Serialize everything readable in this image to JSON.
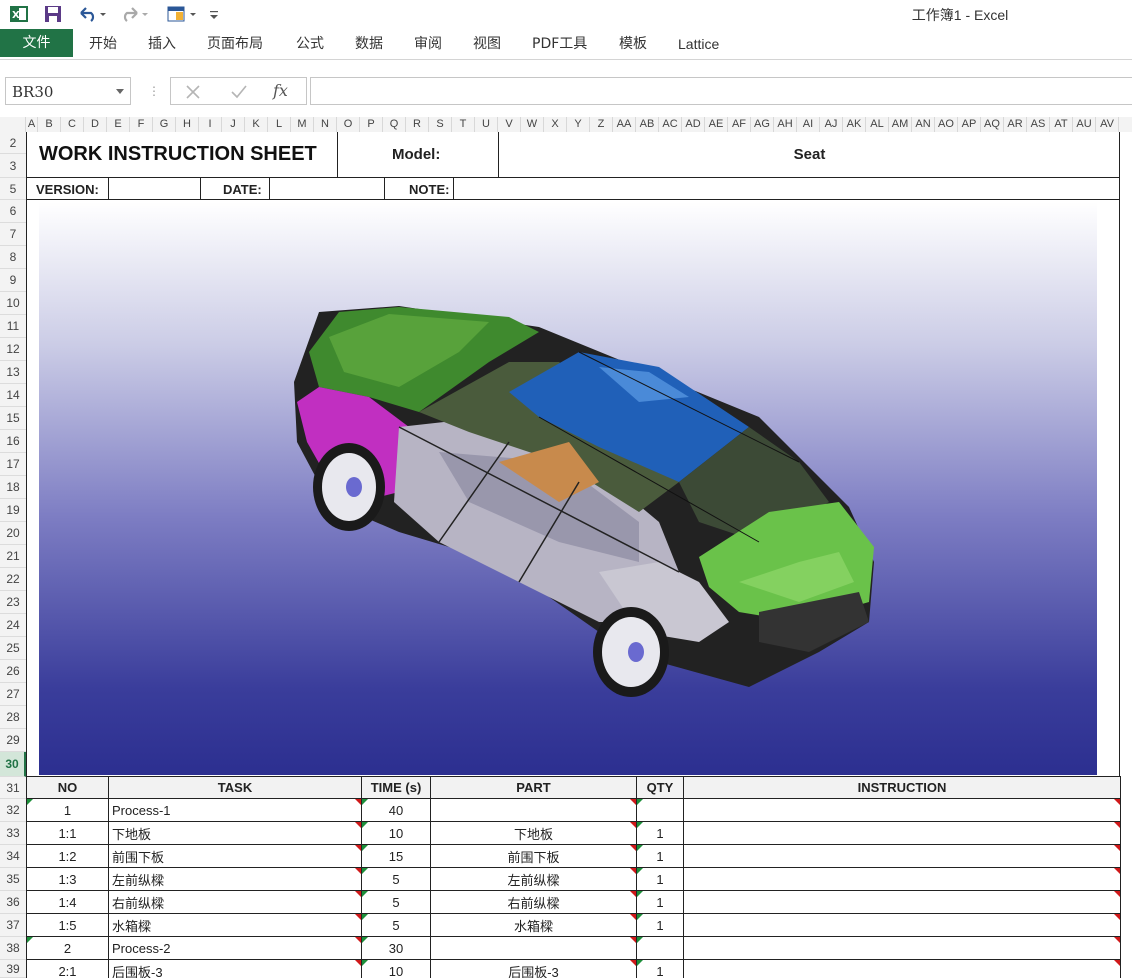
{
  "window": {
    "title": "工作簿1 - Excel"
  },
  "ribbon": {
    "file_tab": "文件",
    "tabs": [
      "开始",
      "插入",
      "页面布局",
      "公式",
      "数据",
      "审阅",
      "视图",
      "PDF工具",
      "模板",
      "Lattice"
    ]
  },
  "formula_bar": {
    "name_box": "BR30",
    "fx": "fx",
    "content": ""
  },
  "columns": [
    "A",
    "B",
    "C",
    "D",
    "E",
    "F",
    "G",
    "H",
    "I",
    "J",
    "K",
    "L",
    "M",
    "N",
    "O",
    "P",
    "Q",
    "R",
    "S",
    "T",
    "U",
    "V",
    "W",
    "X",
    "Y",
    "Z",
    "AA",
    "AB",
    "AC",
    "AD",
    "AE",
    "AF",
    "AG",
    "AH",
    "AI",
    "AJ",
    "AK",
    "AL",
    "AM",
    "AN",
    "AO",
    "AP",
    "AQ",
    "AR",
    "AS",
    "AT",
    "AU",
    "AV"
  ],
  "rows": [
    "2",
    "3",
    "5",
    "6",
    "7",
    "8",
    "9",
    "10",
    "11",
    "12",
    "13",
    "14",
    "15",
    "16",
    "17",
    "18",
    "19",
    "20",
    "21",
    "22",
    "23",
    "24",
    "25",
    "26",
    "27",
    "28",
    "29",
    "30",
    "31",
    "32",
    "33",
    "34",
    "35",
    "36",
    "37",
    "38",
    "39"
  ],
  "active_row": "30",
  "sheet": {
    "title": "WORK INSTRUCTION SHEET",
    "model_label": "Model:",
    "model_value": "Seat",
    "version_label": "VERSION:",
    "date_label": "DATE:",
    "note_label": "NOTE:"
  },
  "table": {
    "headers": [
      "NO",
      "TASK",
      "TIME (s)",
      "PART",
      "QTY",
      "INSTRUCTION"
    ],
    "rows": [
      {
        "no": "1",
        "task": "Process-1",
        "time": "40",
        "part": "",
        "qty": ""
      },
      {
        "no": "1:1",
        "task": "下地板",
        "time": "10",
        "part": "下地板",
        "qty": "1"
      },
      {
        "no": "1:2",
        "task": "前围下板",
        "time": "15",
        "part": "前围下板",
        "qty": "1"
      },
      {
        "no": "1:3",
        "task": "左前纵樑",
        "time": "5",
        "part": "左前纵樑",
        "qty": "1"
      },
      {
        "no": "1:4",
        "task": "右前纵樑",
        "time": "5",
        "part": "右前纵樑",
        "qty": "1"
      },
      {
        "no": "1:5",
        "task": "水箱樑",
        "time": "5",
        "part": "水箱樑",
        "qty": "1"
      },
      {
        "no": "2",
        "task": "Process-2",
        "time": "30",
        "part": "",
        "qty": ""
      },
      {
        "no": "2:1",
        "task": "后围板-3",
        "time": "10",
        "part": "后围板-3",
        "qty": "1"
      }
    ]
  },
  "colors": {
    "excel_green": "#217346",
    "comment_red": "#d0191a",
    "flag_green": "#1d8f3a"
  },
  "icons": [
    "excel-logo-icon",
    "save-icon",
    "undo-icon",
    "redo-icon",
    "customize-icon",
    "car-model-picture"
  ]
}
